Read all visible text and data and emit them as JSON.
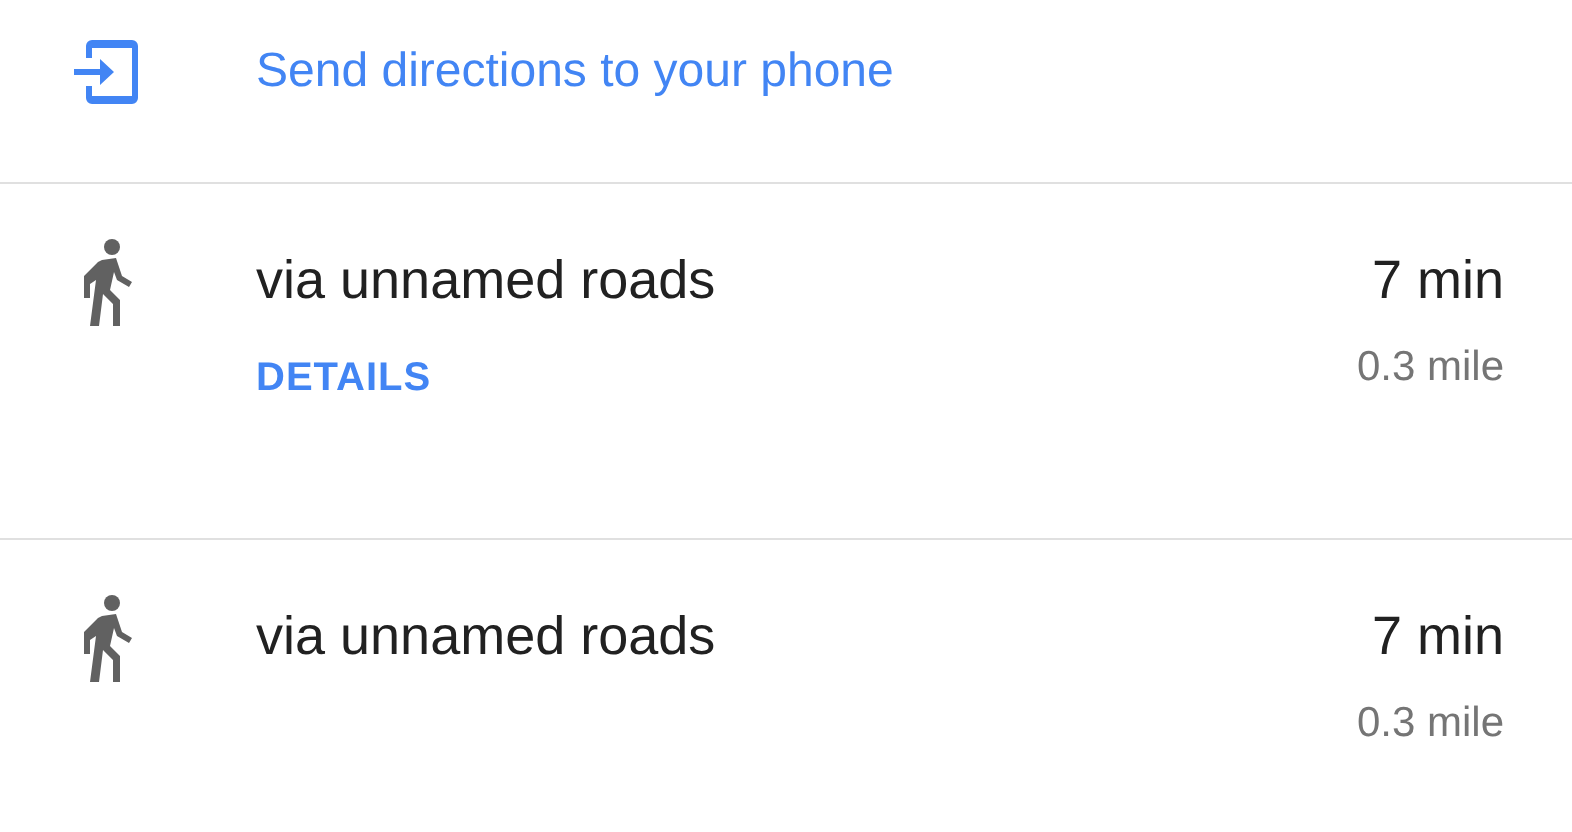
{
  "send_to_phone": {
    "label": "Send directions to your phone"
  },
  "routes": [
    {
      "via": "via unnamed roads",
      "time": "7 min",
      "distance": "0.3 mile",
      "details": "DETAILS"
    },
    {
      "via": "via unnamed roads",
      "time": "7 min",
      "distance": "0.3 mile"
    }
  ]
}
